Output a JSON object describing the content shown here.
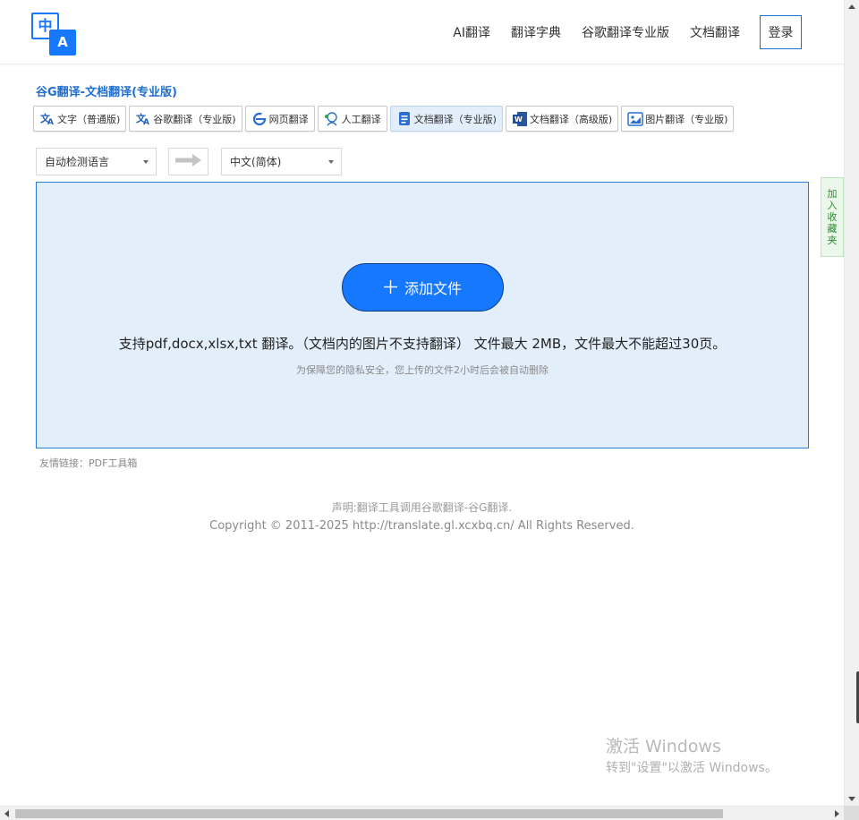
{
  "header": {
    "logo": {
      "top_char": "中",
      "bottom_char": "A"
    },
    "nav": [
      {
        "label": "AI翻译"
      },
      {
        "label": "翻译字典"
      },
      {
        "label": "谷歌翻译专业版"
      },
      {
        "label": "文档翻译"
      }
    ],
    "login_label": "登录"
  },
  "page_title": "谷G翻译-文档翻译(专业版)",
  "tabs": [
    {
      "label": "文字（普通版)",
      "icon": "translate-icon",
      "active": false
    },
    {
      "label": "谷歌翻译（专业版)",
      "icon": "translate-icon",
      "active": false
    },
    {
      "label": "网页翻译",
      "icon": "browser-icon",
      "active": false
    },
    {
      "label": "人工翻译",
      "icon": "human-translator-icon",
      "active": false
    },
    {
      "label": "文档翻译（专业版)",
      "icon": "document-icon",
      "active": true
    },
    {
      "label": "文档翻译（高级版)",
      "icon": "word-document-icon",
      "active": false
    },
    {
      "label": "图片翻译（专业版)",
      "icon": "image-icon",
      "active": false
    }
  ],
  "lang": {
    "source": "自动检测语言",
    "target": "中文(简体)"
  },
  "upload": {
    "add_button": "添加文件",
    "support_text": "支持pdf,docx,xlsx,txt 翻译。（文档内的图片不支持翻译） 文件最大 2MB，文件最大不能超过30页。",
    "privacy_text": "为保障您的隐私安全，您上传的文件2小时后会被自动删除"
  },
  "friendly_links": "友情链接：PDF工具箱",
  "footer": {
    "disclaimer": "声明:翻译工具调用谷歌翻译-谷G翻译.",
    "copyright": "Copyright © 2011-2025 http://translate.gl.xcxbq.cn/ All Rights Reserved."
  },
  "favorite_tab": [
    "加",
    "入",
    "收",
    "藏",
    "夹"
  ],
  "watermark": {
    "line1": "激活 Windows",
    "line2": "转到\"设置\"以激活 Windows。"
  },
  "colors": {
    "accent": "#1677ff",
    "title": "#1f6fd1",
    "upload_bg": "#e3eefb",
    "favorite_text": "#2f8a2f"
  }
}
